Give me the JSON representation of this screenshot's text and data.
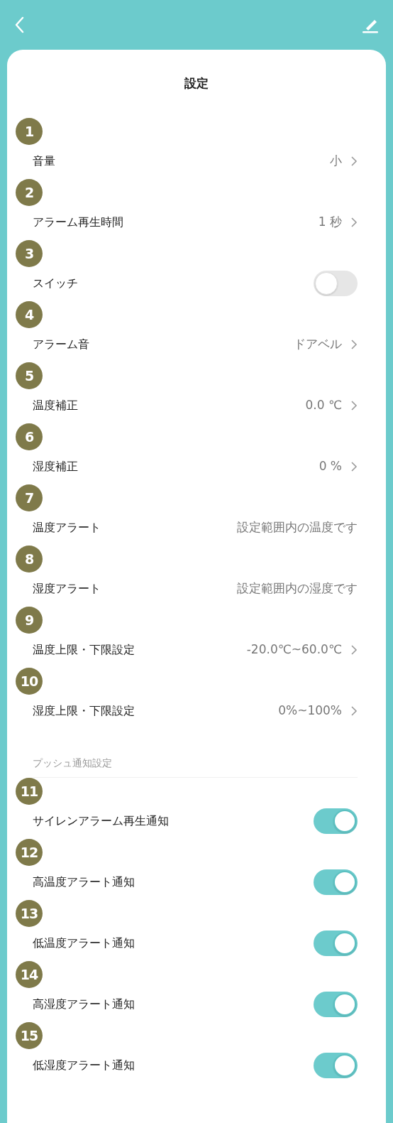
{
  "title": "設定",
  "rows": [
    {
      "badge": "1",
      "label": "音量",
      "kind": "value",
      "value": "小",
      "chevron": true
    },
    {
      "badge": "2",
      "label": "アラーム再生時間",
      "kind": "value",
      "value": "1 秒",
      "chevron": true
    },
    {
      "badge": "3",
      "label": "スイッチ",
      "kind": "switch",
      "on": false
    },
    {
      "badge": "4",
      "label": "アラーム音",
      "kind": "value",
      "value": "ドアベル",
      "chevron": true
    },
    {
      "badge": "5",
      "label": "温度補正",
      "kind": "value",
      "value": "0.0 ℃",
      "chevron": true
    },
    {
      "badge": "6",
      "label": "湿度補正",
      "kind": "value",
      "value": "0 %",
      "chevron": true
    },
    {
      "badge": "7",
      "label": "温度アラート",
      "kind": "value",
      "value": "設定範囲内の温度です",
      "chevron": false
    },
    {
      "badge": "8",
      "label": "湿度アラート",
      "kind": "value",
      "value": "設定範囲内の湿度です",
      "chevron": false
    },
    {
      "badge": "9",
      "label": "温度上限・下限設定",
      "kind": "value",
      "value": "-20.0℃~60.0℃",
      "chevron": true
    },
    {
      "badge": "10",
      "label": "湿度上限・下限設定",
      "kind": "value",
      "value": "0%~100%",
      "chevron": true
    }
  ],
  "section": {
    "title": "プッシュ通知設定",
    "rows": [
      {
        "badge": "11",
        "label": "サイレンアラーム再生通知",
        "kind": "switch",
        "on": true
      },
      {
        "badge": "12",
        "label": "高温度アラート通知",
        "kind": "switch",
        "on": true
      },
      {
        "badge": "13",
        "label": "低温度アラート通知",
        "kind": "switch",
        "on": true
      },
      {
        "badge": "14",
        "label": "高湿度アラート通知",
        "kind": "switch",
        "on": true
      },
      {
        "badge": "15",
        "label": "低湿度アラート通知",
        "kind": "switch",
        "on": true
      }
    ]
  }
}
